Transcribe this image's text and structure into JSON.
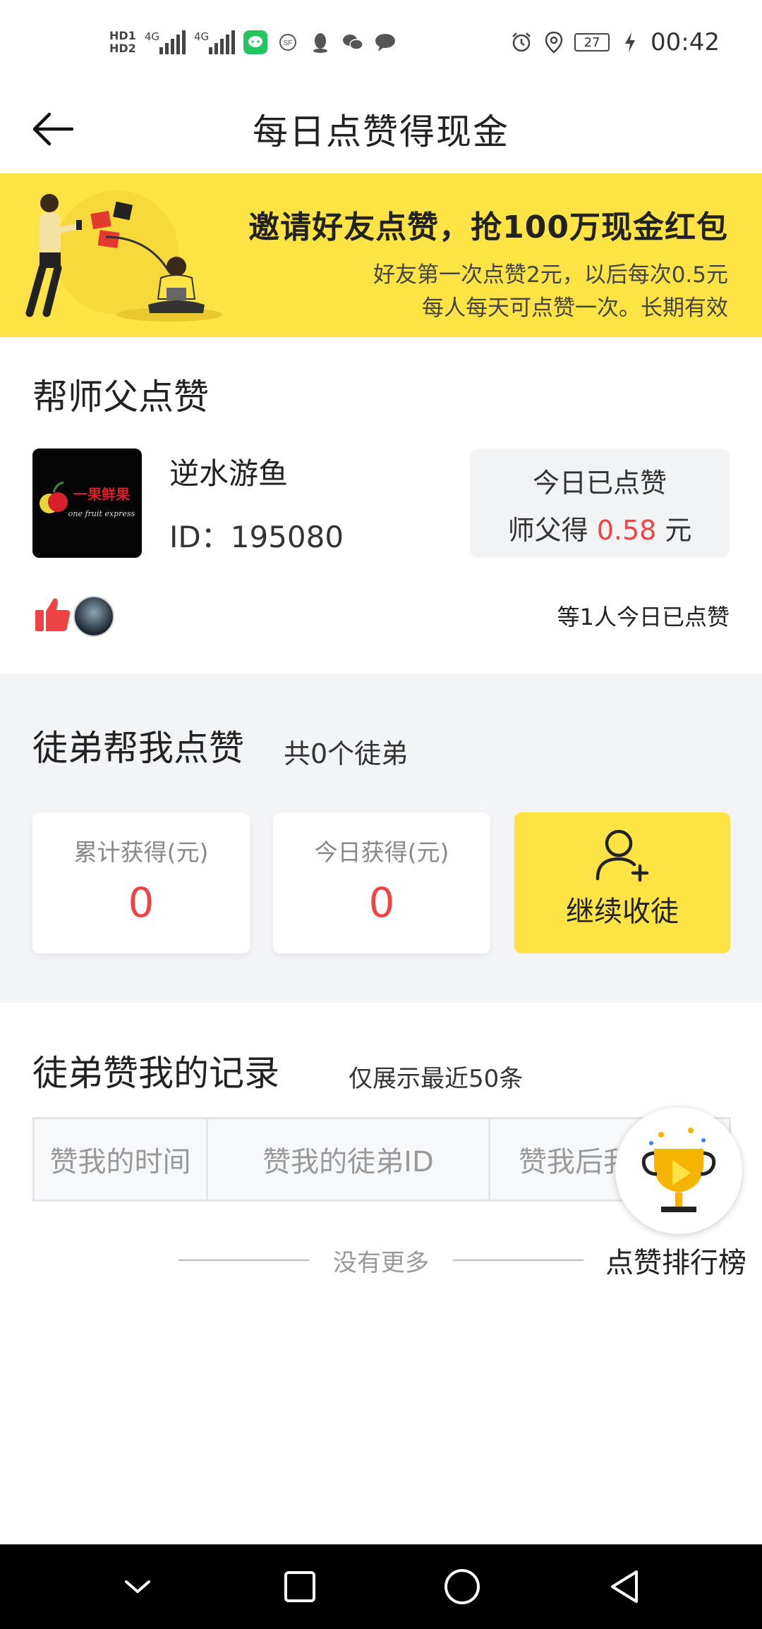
{
  "status_bar": {
    "sim1": "HD1",
    "sim2": "HD2",
    "network1": "4G",
    "network2": "4G",
    "battery": "27",
    "time": "00:42"
  },
  "header": {
    "title": "每日点赞得现金"
  },
  "banner": {
    "title": "邀请好友点赞，抢100万现金红包",
    "line1": "好友第一次点赞2元，以后每次0.5元",
    "line2": "每人每天可点赞一次。长期有效",
    "bg_color": "#fde444"
  },
  "master": {
    "section_title": "帮师父点赞",
    "name": "逆水游鱼",
    "id_text": "ID：195080",
    "logo_text_cn": "一果鲜果",
    "logo_text_en": "one fruit express",
    "today_label": "今日已点赞",
    "earn_prefix": "师父得",
    "earn_value": "0.58",
    "earn_suffix": "元",
    "liked_count_text": "等1人今日已点赞"
  },
  "apprentice": {
    "section_title": "徒弟帮我点赞",
    "count_text": "共0个徒弟",
    "total_label": "累计获得(元)",
    "total_value": "0",
    "today_label": "今日获得(元)",
    "today_value": "0",
    "recruit_label": "继续收徒"
  },
  "records": {
    "section_title": "徒弟赞我的记录",
    "note": "仅展示最近50条",
    "columns": [
      "赞我的时间",
      "赞我的徒弟ID",
      "赞我后我"
    ],
    "empty_text": "没有更多"
  },
  "ranking": {
    "label": "点赞排行榜"
  },
  "colors": {
    "accent": "#fde444",
    "red": "#ef4444"
  }
}
